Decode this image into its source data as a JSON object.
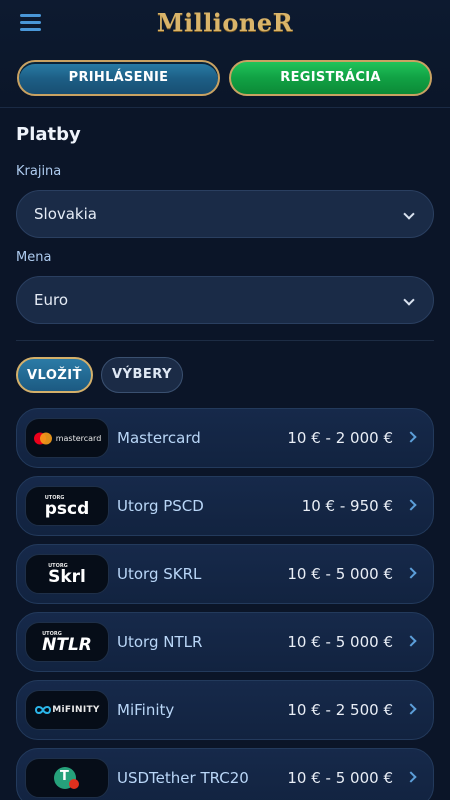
{
  "header": {
    "logo_text": "MillioneR",
    "login_label": "PRIHLÁSENIE",
    "register_label": "REGISTRÁCIA"
  },
  "page": {
    "title": "Platby",
    "country": {
      "label": "Krajina",
      "value": "Slovakia"
    },
    "currency": {
      "label": "Mena",
      "value": "Euro"
    }
  },
  "tabs": {
    "deposit": "VLOŽIŤ",
    "withdraw": "VÝBERY"
  },
  "methods": [
    {
      "name": "Mastercard",
      "range": "10 € - 2 000 €",
      "logo_text": "mastercard"
    },
    {
      "name": "Utorg PSCD",
      "range": "10 € - 950 €",
      "logo_text": "pscd",
      "logo_tag": "UTORG"
    },
    {
      "name": "Utorg SKRL",
      "range": "10 € - 5 000 €",
      "logo_text": "Skrl",
      "logo_tag": "UTORG"
    },
    {
      "name": "Utorg NTLR",
      "range": "10 € - 5 000 €",
      "logo_text": "NTLR",
      "logo_tag": "UTORG"
    },
    {
      "name": "MiFinity",
      "range": "10 € - 2 500 €",
      "logo_text": "MiFINITY"
    },
    {
      "name": "USDTether TRC20",
      "range": "10 € - 5 000 €",
      "logo_text": "T"
    }
  ],
  "colors": {
    "background": "#0a1324",
    "accent_gold": "#c9a262",
    "login_blue": "#1d5f86",
    "register_green": "#11a144"
  }
}
